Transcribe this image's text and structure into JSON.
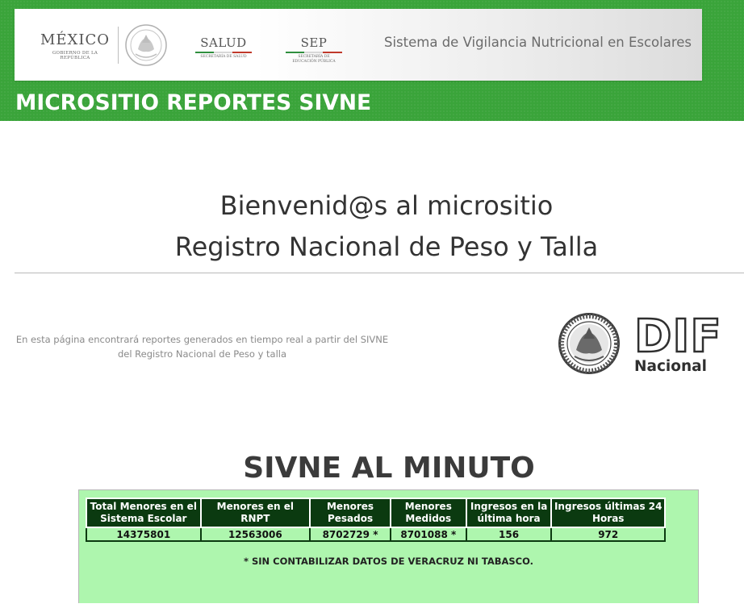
{
  "header": {
    "logo_mexico": {
      "title": "MÉXICO",
      "subtitle": "GOBIERNO DE LA REPÚBLICA"
    },
    "logo_salud": {
      "title": "SALUD",
      "subtitle": "SECRETARÍA DE SALUD"
    },
    "logo_sep": {
      "title": "SEP",
      "subtitle_1": "SECRETARÍA DE",
      "subtitle_2": "EDUCACIÓN PÚBLICA"
    },
    "system_title": "Sistema de Vigilancia Nutricional en Escolares",
    "site_title": "MICROSITIO REPORTES SIVNE"
  },
  "welcome": {
    "line1": "Bienvenid@s al micrositio",
    "line2": "Registro Nacional de Peso y Talla"
  },
  "description": "En esta página encontrará reportes generados en tiempo real a partir del SIVNE del Registro Nacional de Peso y talla",
  "dif_logo": {
    "letters": "DIF",
    "subtitle": "Nacional"
  },
  "stats": {
    "title": "SIVNE AL MINUTO",
    "headers": [
      "Total Menores en el Sistema Escolar",
      "Menores en el RNPT",
      "Menores Pesados",
      "Menores Medidos",
      "Ingresos en la última hora",
      "Ingresos últimas 24 Horas"
    ],
    "values": [
      "14375801",
      "12563006",
      "8702729 *",
      "8701088 *",
      "156",
      "972"
    ],
    "note": "* SIN CONTABILIZAR DATOS DE VERACRUZ NI TABASCO."
  },
  "colors": {
    "brand_green": "#3aa43a",
    "table_header": "#0b3a10",
    "panel_background": "#aef6ae"
  }
}
